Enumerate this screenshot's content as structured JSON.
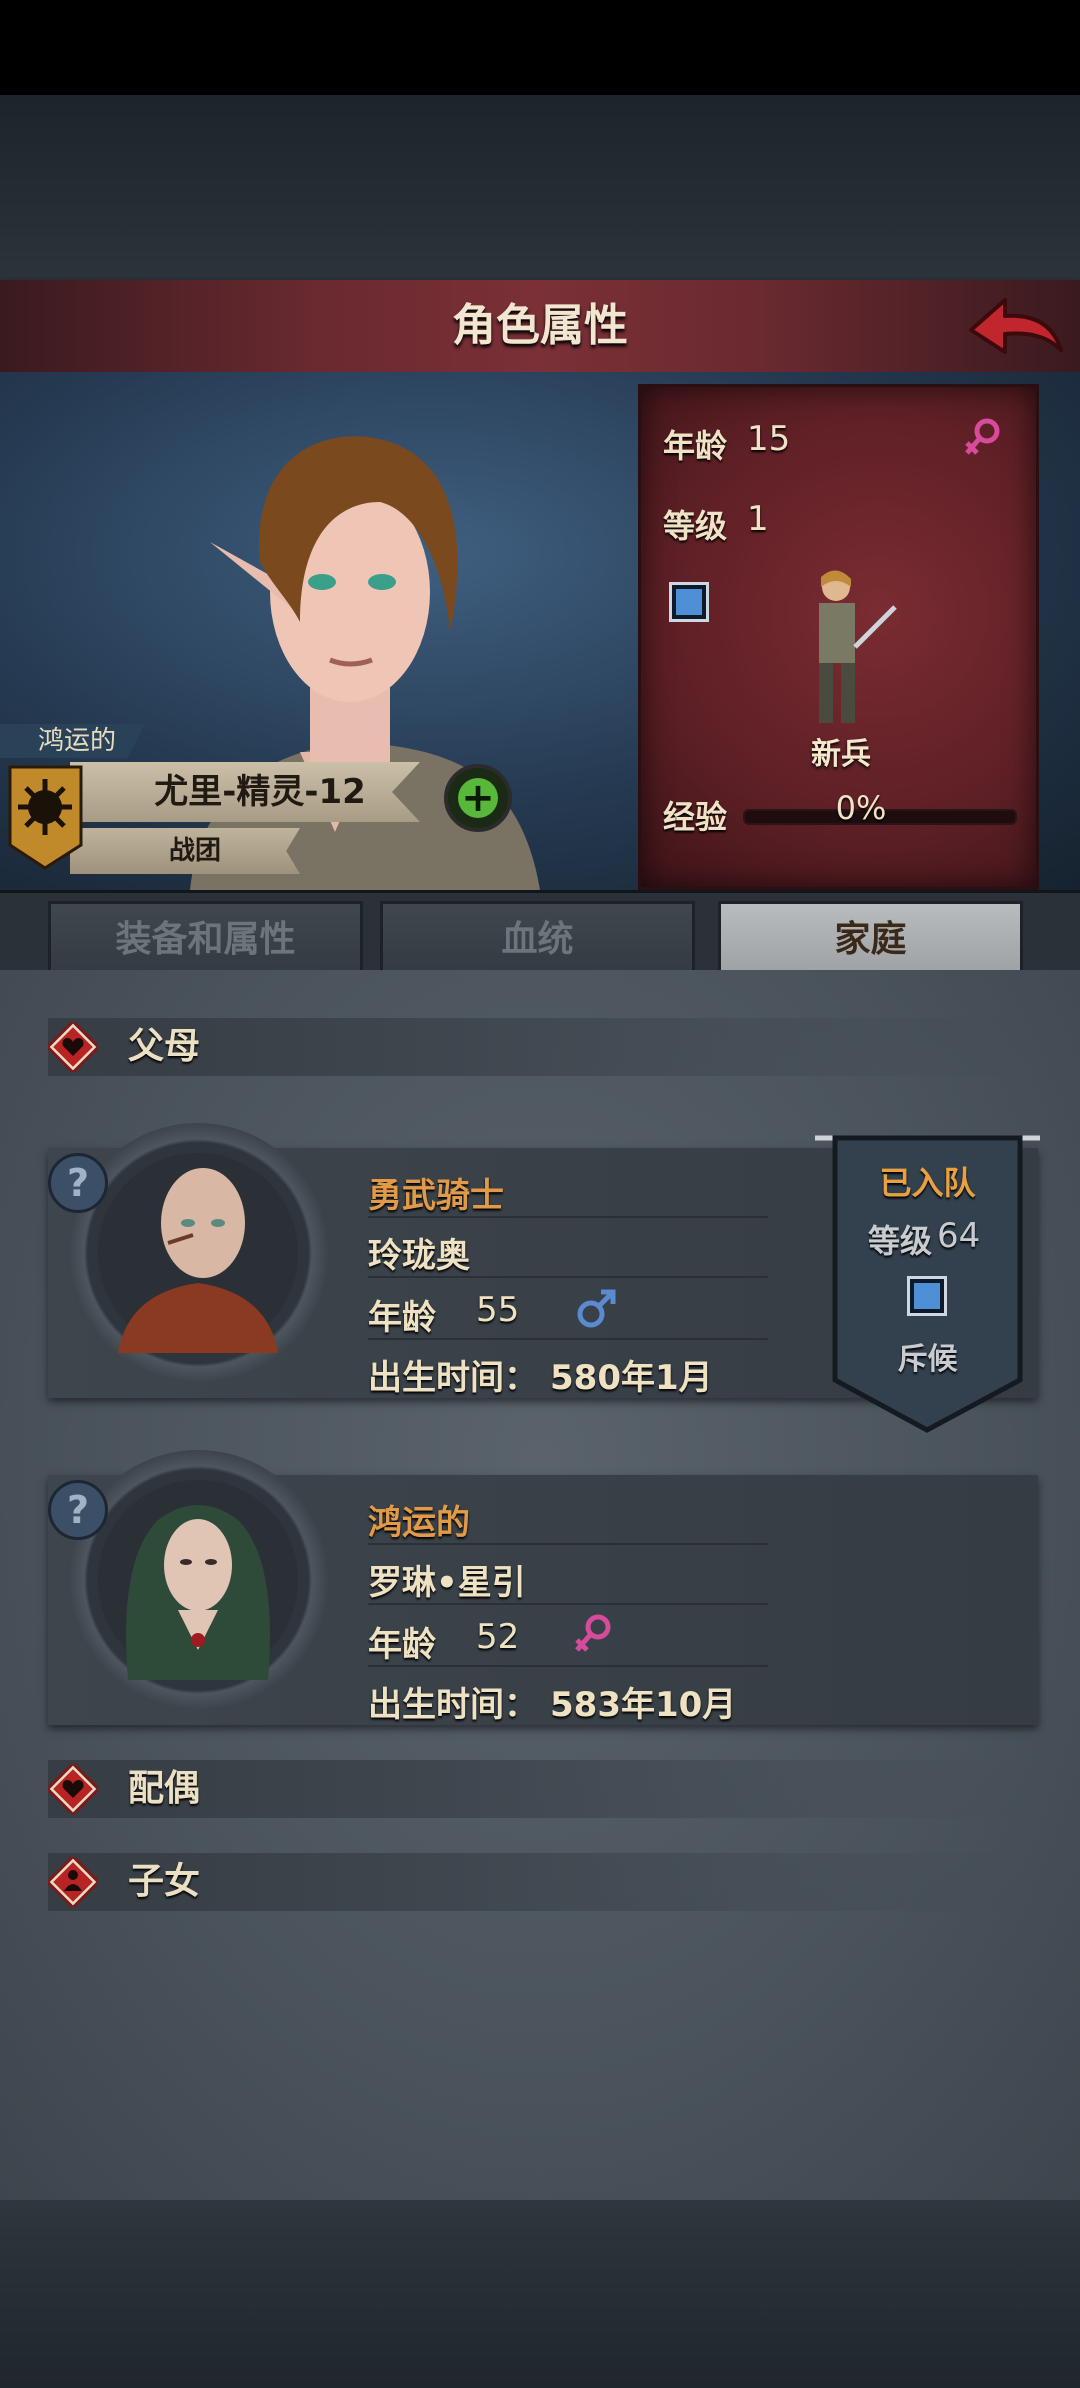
{
  "header": {
    "title": "角色属性"
  },
  "hero": {
    "title_prefix": "鸿运的",
    "name": "尤里-精灵-12",
    "legion": "战团"
  },
  "stats": {
    "age_label": "年龄",
    "age": "15",
    "gender": "female",
    "level_label": "等级",
    "level": "1",
    "class_name": "新兵",
    "xp_label": "经验",
    "xp_percent": "0%",
    "xp_fraction": 0
  },
  "tabs": [
    {
      "label": "装备和属性",
      "active": false
    },
    {
      "label": "血统",
      "active": false
    },
    {
      "label": "家庭",
      "active": true
    }
  ],
  "sections": {
    "parents": "父母",
    "spouse": "配偶",
    "children": "子女"
  },
  "parents": [
    {
      "title": "勇武骑士",
      "name": "玲珑奥",
      "age_label": "年龄",
      "age": "55",
      "gender": "male",
      "birth_label": "出生时间：",
      "birth": "580年1月",
      "status": {
        "joined": "已入队",
        "level_label": "等级",
        "level": "64",
        "class_name": "斥候"
      }
    },
    {
      "title": "鸿运的",
      "name": "罗琳•星引",
      "age_label": "年龄",
      "age": "52",
      "gender": "female",
      "birth_label": "出生时间：",
      "birth": "583年10月"
    }
  ],
  "colors": {
    "title_bar": "#6a2a30",
    "accent_orange": "#e09a48",
    "female": "#d84a9a",
    "male": "#5a8ad0",
    "plus_green": "#58b83a"
  },
  "icons": {
    "back": "back-arrow-icon",
    "add": "plus-icon",
    "weapon": "sword-icon",
    "help": "question-icon",
    "heart": "heart-icon",
    "child": "child-icon"
  }
}
